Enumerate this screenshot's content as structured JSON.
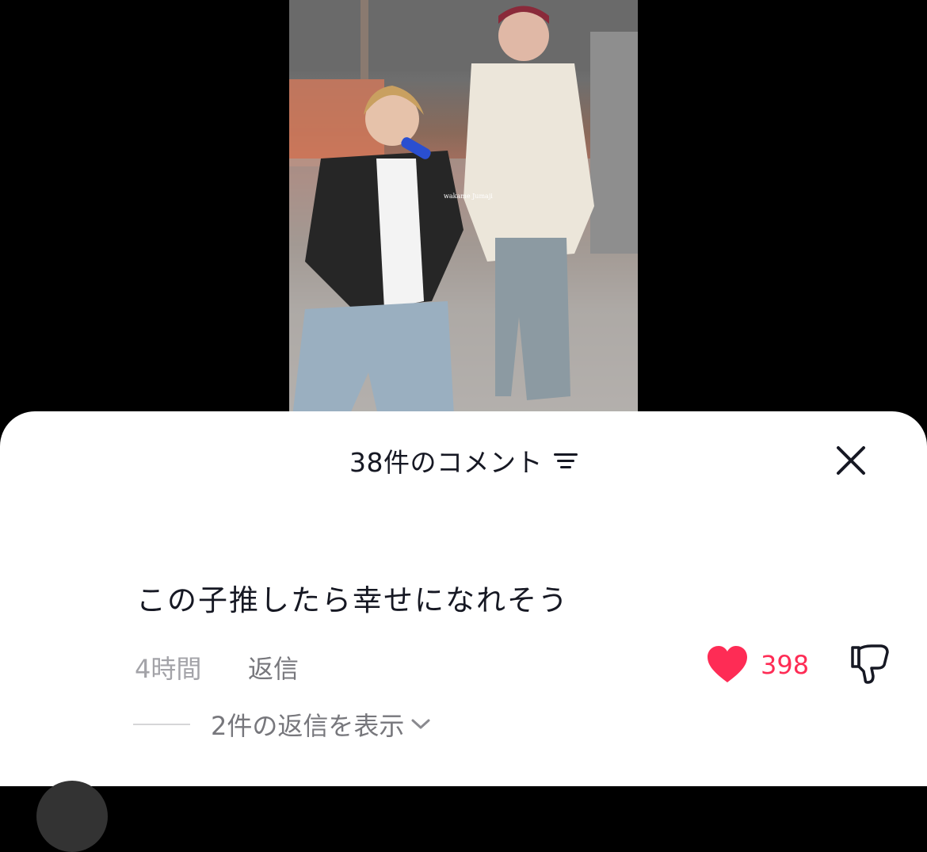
{
  "video": {
    "watermark": "wakame Jumaji"
  },
  "comments_sheet": {
    "title": "38件のコメント",
    "sort_icon": "sort-lines-icon",
    "close_icon": "close-x-icon"
  },
  "comment": {
    "text": "この子推したら幸せになれそう",
    "time": "4時間",
    "reply_label": "返信",
    "likes": "398",
    "like_icon": "heart-filled-icon",
    "dislike_icon": "thumbs-down-icon",
    "view_replies_label": "2件の返信を表示",
    "accent_color": "#fe2c55"
  }
}
